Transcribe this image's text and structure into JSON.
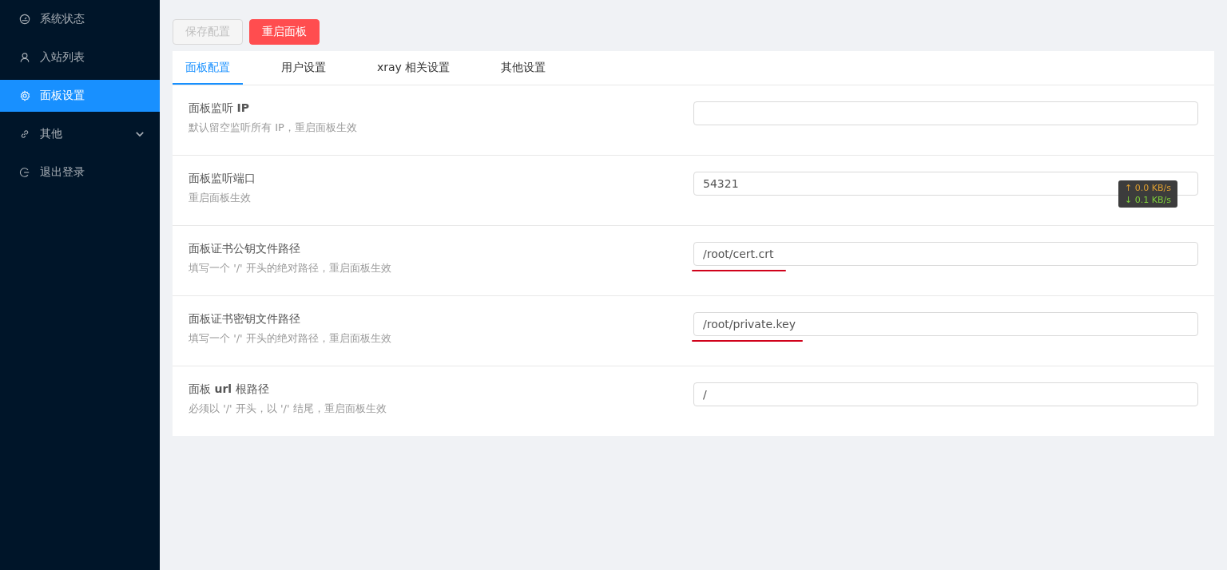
{
  "sidebar": {
    "items": [
      {
        "label": "系统状态",
        "kind": "item",
        "selected": false
      },
      {
        "label": "入站列表",
        "kind": "item",
        "selected": false
      },
      {
        "label": "面板设置",
        "kind": "item",
        "selected": true
      },
      {
        "label": "其他",
        "kind": "submenu",
        "selected": false
      },
      {
        "label": "退出登录",
        "kind": "item",
        "selected": false
      }
    ]
  },
  "toolbar": {
    "buttons": [
      {
        "label": "保存配置",
        "kind": "default",
        "disabled": true
      },
      {
        "label": "重启面板",
        "kind": "danger",
        "disabled": false
      }
    ]
  },
  "tabs": [
    {
      "label": "面板配置",
      "selected": true
    },
    {
      "label": "用户设置",
      "selected": false
    },
    {
      "label": "xray 相关设置",
      "selected": false
    },
    {
      "label": "其他设置",
      "selected": false
    }
  ],
  "settings": [
    {
      "label": "面板监听 **IP**",
      "hint": "默认留空监听所有 IP，重启面板生效",
      "underlined": false
    },
    {
      "label": "面板监听端口",
      "hint": "重启面板生效",
      "value": "54321",
      "underlined": false
    },
    {
      "label": "面板证书公钥文件路径",
      "hint": "填写一个 '/' 开头的绝对路径，重启面板生效",
      "value": "/root/cert.crt",
      "underlined": true
    },
    {
      "label": "面板证书密钥文件路径",
      "hint": "填写一个 '/' 开头的绝对路径，重启面板生效",
      "value": "/root/private.key",
      "underlined": true
    },
    {
      "label": "面板 **url** 根路径",
      "hint": "必须以 '/' 开头，以 '/' 结尾，重启面板生效",
      "value": "/",
      "underlined": false
    }
  ],
  "speed_overlay": {
    "upload": "↑ 0.0 KB/s",
    "download": "↓ 0.1 KB/s"
  }
}
